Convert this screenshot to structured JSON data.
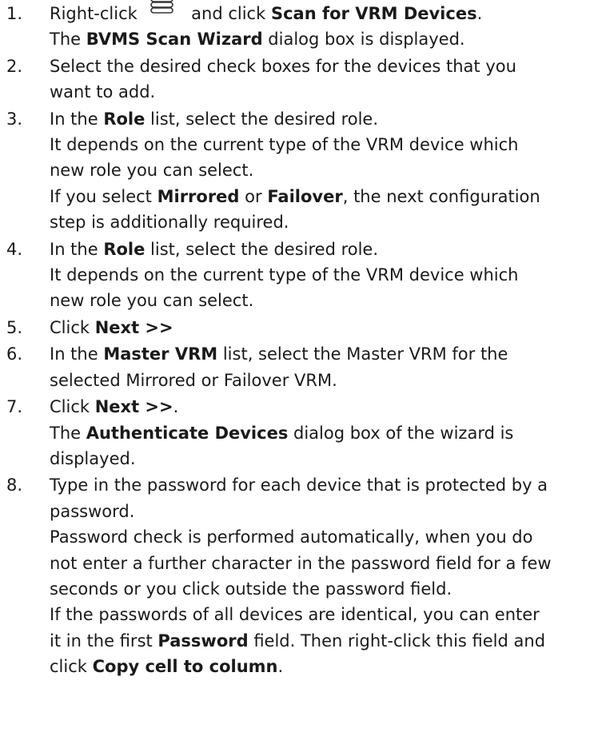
{
  "steps": [
    {
      "number": "1.",
      "lines": [
        [
          "Right-click ",
          {
            "icon": "vrm-device-icon"
          },
          " and click ",
          {
            "b": "Scan for VRM Devices"
          },
          "."
        ],
        [
          "The ",
          {
            "b": "BVMS Scan Wizard"
          },
          " dialog box is displayed."
        ]
      ]
    },
    {
      "number": "2.",
      "lines": [
        [
          "Select the desired check boxes for the devices that you"
        ],
        [
          "want to add."
        ]
      ]
    },
    {
      "number": "3.",
      "lines": [
        [
          "In the ",
          {
            "b": "Role"
          },
          " list, select the desired role."
        ],
        [
          "It depends on the current type of the VRM device which"
        ],
        [
          "new role you can select."
        ],
        [
          "If you select ",
          {
            "b": "Mirrored"
          },
          " or ",
          {
            "b": "Failover"
          },
          ", the next configuration"
        ],
        [
          "step is additionally required."
        ]
      ]
    },
    {
      "number": "4.",
      "lines": [
        [
          "In the ",
          {
            "b": "Role"
          },
          " list, select the desired role."
        ],
        [
          "It depends on the current type of the VRM device which"
        ],
        [
          "new role you can select."
        ]
      ]
    },
    {
      "number": "5.",
      "lines": [
        [
          "Click ",
          {
            "b": "Next >>"
          }
        ]
      ]
    },
    {
      "number": "6.",
      "lines": [
        [
          "In the ",
          {
            "b": "Master VRM"
          },
          " list, select the Master VRM for the"
        ],
        [
          "selected Mirrored or Failover VRM."
        ]
      ]
    },
    {
      "number": "7.",
      "lines": [
        [
          "Click ",
          {
            "b": "Next >>"
          },
          "."
        ],
        [
          "The ",
          {
            "b": "Authenticate Devices"
          },
          " dialog box of the wizard is"
        ],
        [
          "displayed."
        ]
      ]
    },
    {
      "number": "8.",
      "lines": [
        [
          "Type in the password for each device that is protected by a"
        ],
        [
          "password."
        ],
        [
          "Password check is performed automatically, when you do"
        ],
        [
          "not enter a further character in the password field for a few"
        ],
        [
          "seconds or you click outside the password field."
        ],
        [
          "If the passwords of all devices are identical, you can enter"
        ],
        [
          "it in the first ",
          {
            "b": "Password"
          },
          " field. Then right-click this field and"
        ],
        [
          "click ",
          {
            "b": "Copy cell to column"
          },
          "."
        ]
      ]
    }
  ]
}
